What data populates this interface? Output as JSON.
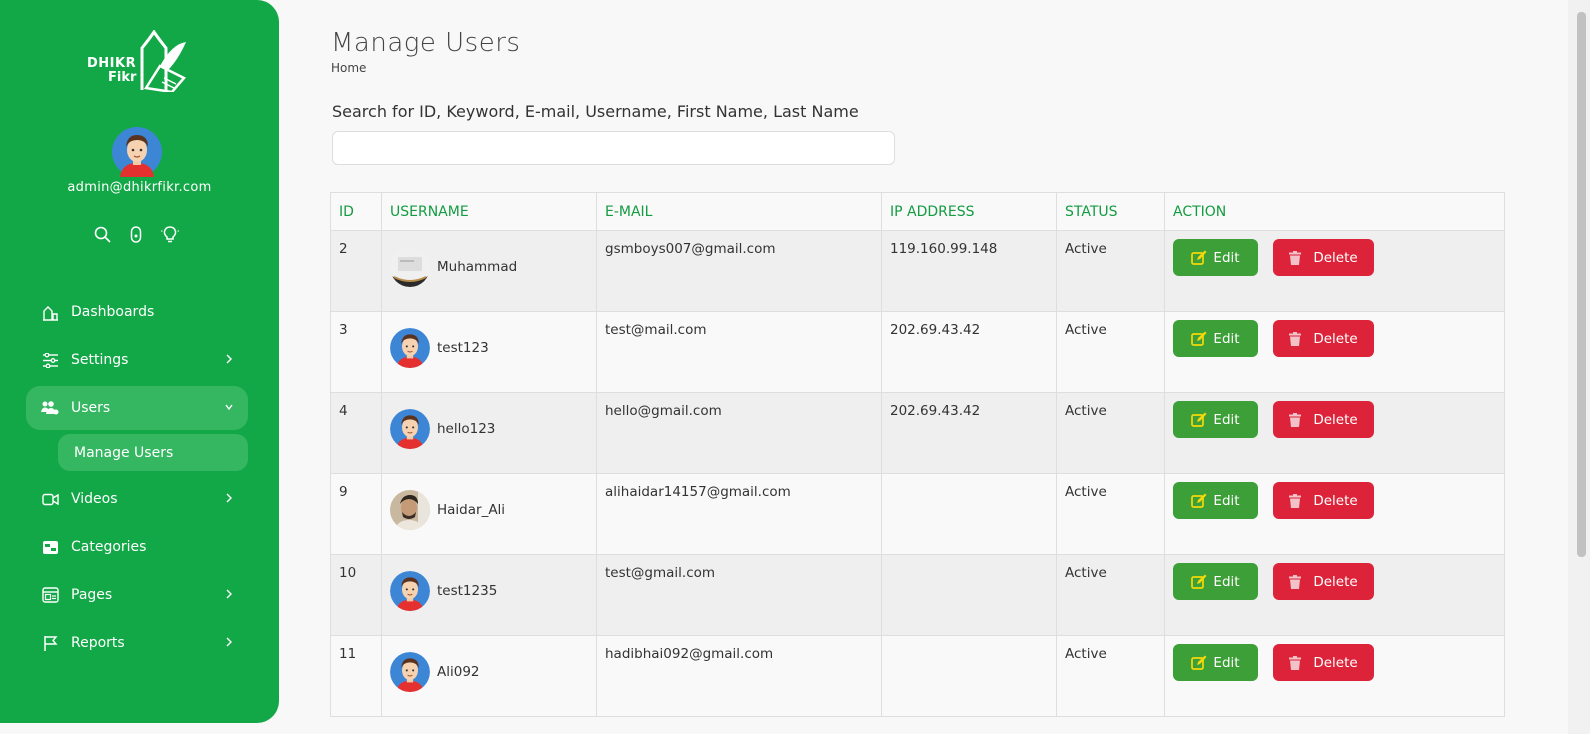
{
  "brand": {
    "line1": "DHIKR",
    "line2": "Fikr"
  },
  "profile": {
    "email": "admin@dhikrfikr.com"
  },
  "quick_icons": [
    "search-icon",
    "lock-icon",
    "lightbulb-icon"
  ],
  "nav": {
    "dashboards": "Dashboards",
    "settings": "Settings",
    "users": "Users",
    "manage_users": "Manage Users",
    "videos": "Videos",
    "categories": "Categories",
    "pages": "Pages",
    "reports": "Reports"
  },
  "header": {
    "title": "Manage Users",
    "breadcrumb": "Home"
  },
  "search": {
    "label": "Search for ID, Keyword, E-mail, Username, First Name, Last Name",
    "value": ""
  },
  "table": {
    "columns": {
      "id": "ID",
      "username": "USERNAME",
      "email": "E-MAIL",
      "ip": "IP ADDRESS",
      "status": "STATUS",
      "action": "ACTION"
    },
    "edit_label": "Edit",
    "delete_label": "Delete",
    "rows": [
      {
        "id": "2",
        "username": "Muhammad",
        "email": "gsmboys007@gmail.com",
        "ip": "119.160.99.148",
        "status": "Active",
        "avatar": "photo-blurred"
      },
      {
        "id": "3",
        "username": "test123",
        "email": "test@mail.com",
        "ip": "202.69.43.42",
        "status": "Active",
        "avatar": "cartoon"
      },
      {
        "id": "4",
        "username": "hello123",
        "email": "hello@gmail.com",
        "ip": "202.69.43.42",
        "status": "Active",
        "avatar": "cartoon"
      },
      {
        "id": "9",
        "username": "Haidar_Ali",
        "email": "alihaidar14157@gmail.com",
        "ip": "",
        "status": "Active",
        "avatar": "photo"
      },
      {
        "id": "10",
        "username": "test1235",
        "email": "test@gmail.com",
        "ip": "",
        "status": "Active",
        "avatar": "cartoon"
      },
      {
        "id": "11",
        "username": "Ali092",
        "email": "hadibhai092@gmail.com",
        "ip": "",
        "status": "Active",
        "avatar": "cartoon"
      }
    ]
  },
  "colors": {
    "sidebar": "#13a847",
    "accent": "#139c42",
    "edit": "#3c9f37",
    "delete": "#dc2339"
  }
}
